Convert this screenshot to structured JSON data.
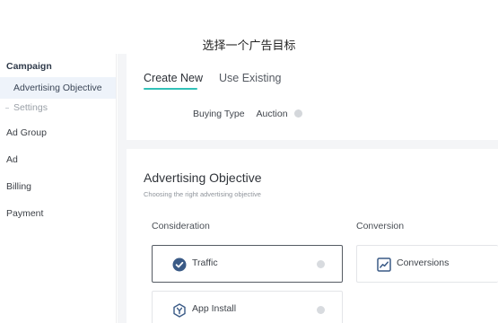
{
  "caption": "选择一个广告目标",
  "sidebar": {
    "campaign": "Campaign",
    "advertising_objective": "Advertising Objective",
    "settings": "Settings",
    "ad_group": "Ad Group",
    "ad": "Ad",
    "billing": "Billing",
    "payment": "Payment"
  },
  "tabs": {
    "create_new": "Create New",
    "use_existing": "Use Existing"
  },
  "buying": {
    "label": "Buying Type",
    "value": "Auction"
  },
  "objective": {
    "title": "Advertising Objective",
    "subtitle": "Choosing the right advertising objective",
    "consideration_label": "Consideration",
    "conversion_label": "Conversion",
    "cards": {
      "traffic": "Traffic",
      "app_install": "App Install",
      "conversions": "Conversions"
    }
  },
  "colors": {
    "accent": "#31c1b8",
    "icon_blue": "#3a5a86",
    "active_nav_bg": "#eef3fa"
  },
  "icons": {
    "traffic": "check-circle-icon",
    "app_install": "shield-y-icon",
    "conversions": "trend-chart-icon",
    "info": "info-icon"
  }
}
